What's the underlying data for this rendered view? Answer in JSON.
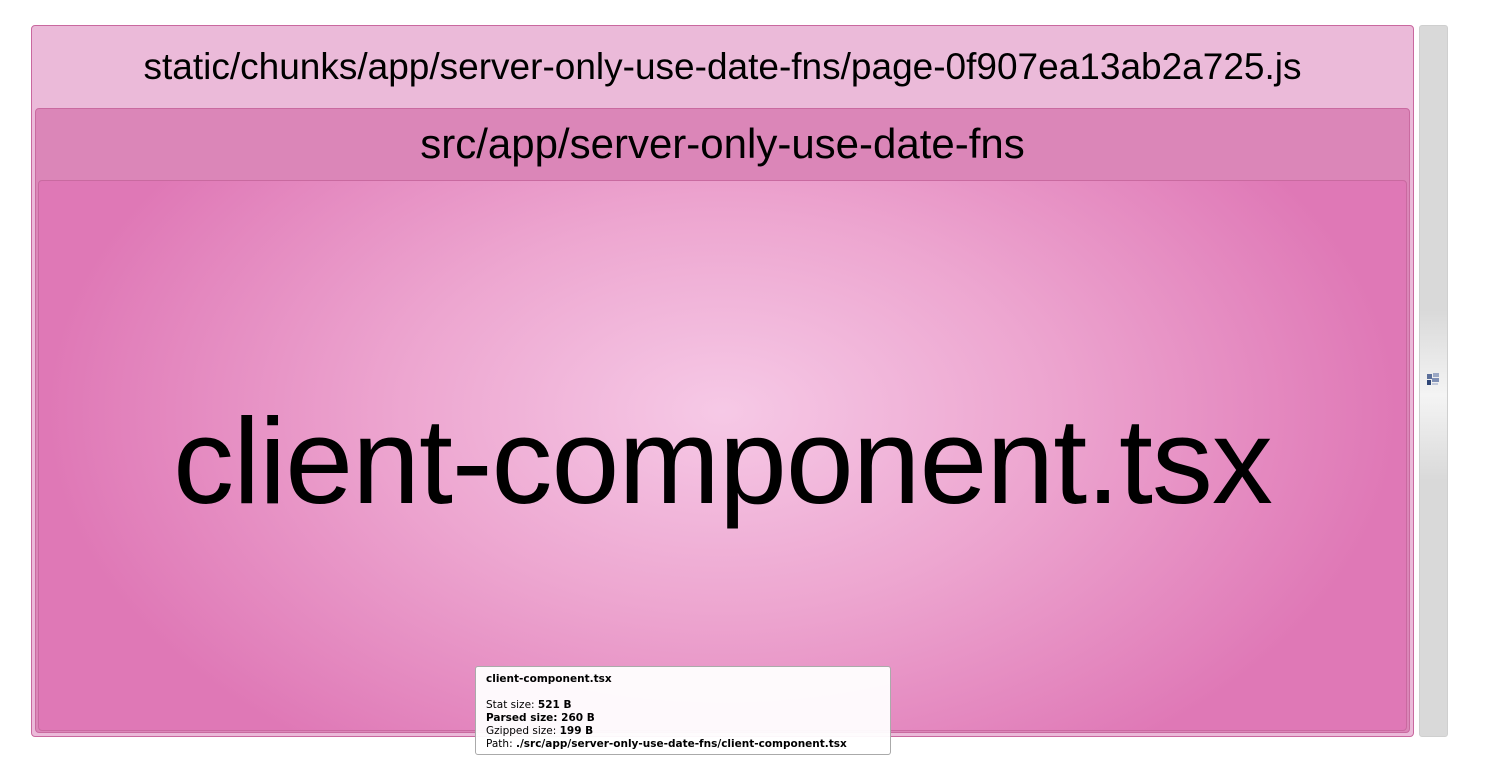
{
  "chunk": {
    "label": "static/chunks/app/server-only-use-date-fns/page-0f907ea13ab2a725.js"
  },
  "folder": {
    "label": "src/app/server-only-use-date-fns"
  },
  "module": {
    "label": "client-component.tsx"
  },
  "colors": {
    "chunk_bg": "#ebbad9",
    "folder_bg": "#db86b8",
    "module_center": "#f6c9e6",
    "module_edge": "#df78b6"
  },
  "tooltip": {
    "title": "client-component.tsx",
    "stat_label": "Stat size:",
    "stat_value": "521 B",
    "parsed_label": "Parsed size:",
    "parsed_value": "260 B",
    "gzip_label": "Gzipped size:",
    "gzip_value": "199 B",
    "path_label": "Path:",
    "path_value": "./src/app/server-only-use-date-fns/client-component.tsx"
  },
  "sidebar": {
    "toggle_icon": "sidebar-toggle-icon"
  }
}
